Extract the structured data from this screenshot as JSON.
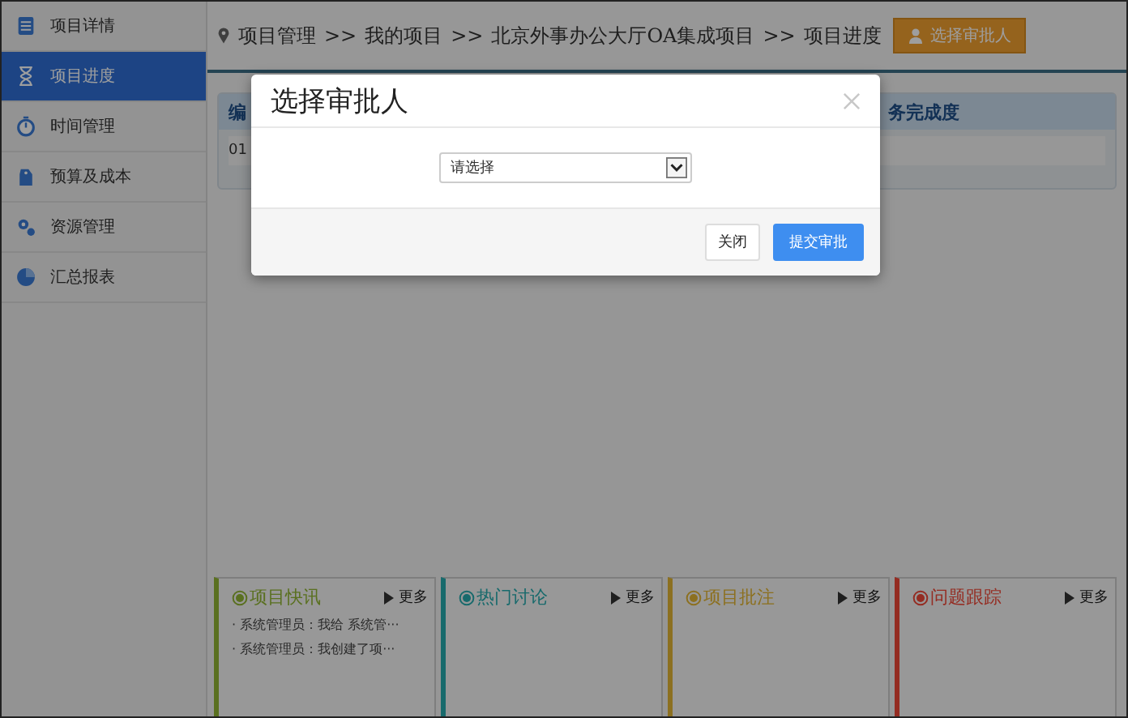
{
  "sidebar": {
    "items": [
      {
        "label": "项目详情",
        "kind": "list",
        "selected": false
      },
      {
        "label": "项目进度",
        "kind": "hourglass",
        "selected": true
      },
      {
        "label": "时间管理",
        "kind": "stopwatch",
        "selected": false
      },
      {
        "label": "预算及成本",
        "kind": "tag",
        "selected": false
      },
      {
        "label": "资源管理",
        "kind": "gears",
        "selected": false
      },
      {
        "label": "汇总报表",
        "kind": "pie",
        "selected": false
      }
    ]
  },
  "breadcrumb": {
    "items": [
      "项目管理",
      "我的项目",
      "北京外事办公大厅OA集成项目",
      "项目进度"
    ],
    "separator": ">>"
  },
  "header_button": "选择审批人",
  "table": {
    "columns": [
      "编",
      "务完成度"
    ],
    "rows": [
      [
        "01"
      ]
    ]
  },
  "panels": [
    {
      "title": "项目快讯",
      "color": "#5a7020",
      "more": "更多",
      "items": [
        "· 系统管理员：我给 系统管···",
        "· 系统管理员：我创建了项···"
      ]
    },
    {
      "title": "热门讨论",
      "color": "#186a6c",
      "more": "更多"
    },
    {
      "title": "项目批注",
      "color": "#8c7020",
      "more": "更多"
    },
    {
      "title": "问题跟踪",
      "color": "#942c22",
      "more": "更多"
    }
  ],
  "dialog": {
    "title": "选择审批人",
    "select": {
      "value": "请选择"
    },
    "buttons": [
      {
        "label": "关闭",
        "kind": "default"
      },
      {
        "label": "提交审批",
        "kind": "primary"
      }
    ]
  }
}
